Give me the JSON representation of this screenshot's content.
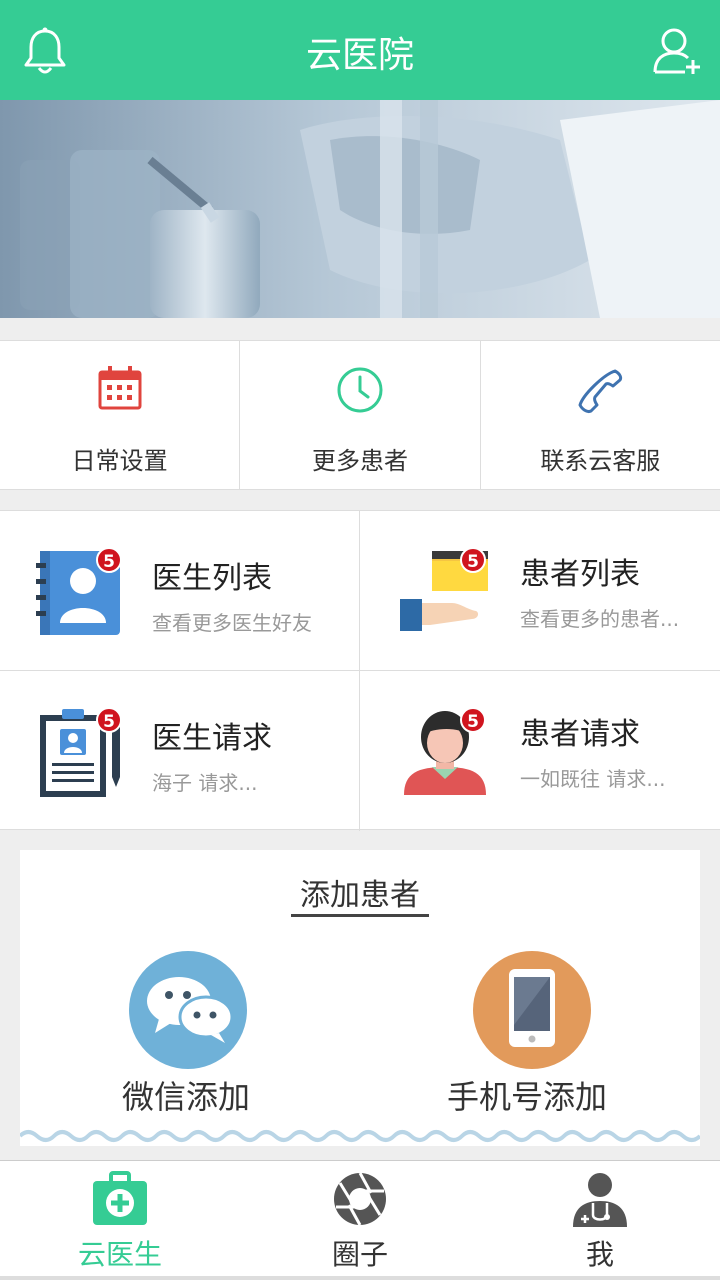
{
  "header": {
    "title": "云医院",
    "left_icon": "bell-icon",
    "right_icon": "add-user-icon",
    "color": "#35cc94"
  },
  "banner": {
    "slides": 3,
    "active_slide": 1
  },
  "quick_actions": [
    {
      "label": "日常设置",
      "icon": "calendar-icon",
      "color": "#e0443e"
    },
    {
      "label": "更多患者",
      "icon": "clock-icon",
      "color": "#35cc94"
    },
    {
      "label": "联系云客服",
      "icon": "phone-icon",
      "color": "#3f73b0"
    }
  ],
  "grid": [
    {
      "title": "医生列表",
      "subtitle": "查看更多医生好友",
      "badge": "5",
      "icon": "contact-book-icon"
    },
    {
      "title": "患者列表",
      "subtitle": "查看更多的患者...",
      "badge": "5",
      "icon": "folder-hand-icon"
    },
    {
      "title": "医生请求",
      "subtitle": "海子  请求...",
      "badge": "5",
      "icon": "clipboard-id-icon"
    },
    {
      "title": "患者请求",
      "subtitle": "一如既往  请求...",
      "badge": "5",
      "icon": "person-icon"
    }
  ],
  "add_patient": {
    "title": "添加患者",
    "options": [
      {
        "label": "微信添加",
        "icon": "wechat-icon",
        "color": "#6fb1d8"
      },
      {
        "label": "手机号添加",
        "icon": "mobile-phone-icon",
        "color": "#e29a5b"
      }
    ]
  },
  "tabbar": [
    {
      "label": "云医生",
      "icon": "medical-kit-icon",
      "active": true
    },
    {
      "label": "圈子",
      "icon": "aperture-icon",
      "active": false
    },
    {
      "label": "我",
      "icon": "doctor-profile-icon",
      "active": false
    }
  ]
}
